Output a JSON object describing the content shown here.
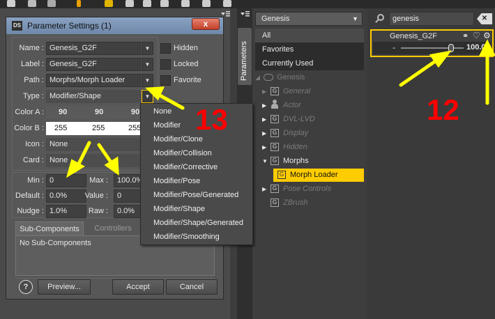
{
  "dialog": {
    "logo": "DS",
    "title": "Parameter Settings (1)",
    "close_glyph": "x",
    "name_label": "Name :",
    "name_value": "Genesis_G2F",
    "label_label": "Label :",
    "label_value": "Genesis_G2F",
    "path_label": "Path :",
    "path_value": "Morphs/Morph Loader",
    "type_label": "Type :",
    "type_value": "Modifier/Shape",
    "hidden_label": "Hidden",
    "locked_label": "Locked",
    "favorite_label": "Favorite",
    "color_a_label": "Color A :",
    "color_a_values": [
      "90",
      "90",
      "90"
    ],
    "color_b_label": "Color B :",
    "color_b_values": [
      "255",
      "255",
      "255"
    ],
    "icon_label": "Icon :",
    "icon_value": "None",
    "card_label": "Card :",
    "card_value": "None",
    "min_label": "Min :",
    "min_value": "0",
    "max_label": "Max :",
    "max_value": "100.0%",
    "default_label": "Default :",
    "default_value": "0.0%",
    "value_label": "Value :",
    "value_value": "0",
    "nudge_label": "Nudge :",
    "nudge_value": "1.0%",
    "raw_label": "Raw :",
    "raw_value": "0.0%",
    "tabs": [
      "Sub-Components",
      "Controllers"
    ],
    "sub_components_text": "No Sub-Components",
    "help_glyph": "?",
    "preview_label": "Preview...",
    "accept_label": "Accept",
    "cancel_label": "Cancel"
  },
  "type_menu": {
    "items": [
      "None",
      "Modifier",
      "Modifier/Clone",
      "Modifier/Collision",
      "Modifier/Corrective",
      "Modifier/Pose",
      "Modifier/Pose/Generated",
      "Modifier/Shape",
      "Modifier/Shape/Generated",
      "Modifier/Smoothing"
    ]
  },
  "side_tab": {
    "label": "Parameters"
  },
  "middle_panel": {
    "figure_select": "Genesis",
    "filters": [
      "All",
      "Favorites",
      "Currently Used"
    ],
    "tree_root": "Genesis",
    "groups": [
      "General",
      "Actor",
      "DVL-LVD",
      "Display",
      "Hidden",
      "Morphs",
      "Morph Loader",
      "Pose Controls",
      "ZBrush"
    ]
  },
  "right_panel": {
    "search_value": "genesis",
    "param_name": "Genesis_G2F",
    "param_value": "100.0",
    "slider_fraction": 0.8
  },
  "annotations": {
    "label_13": "13",
    "label_12": "12",
    "arrow_color": "#ffff00",
    "number_color": "#ff0000"
  },
  "colors": {
    "highlight": "#ffcc00",
    "dialog_bg": "#575757",
    "title_blue": "#7c94b6"
  }
}
